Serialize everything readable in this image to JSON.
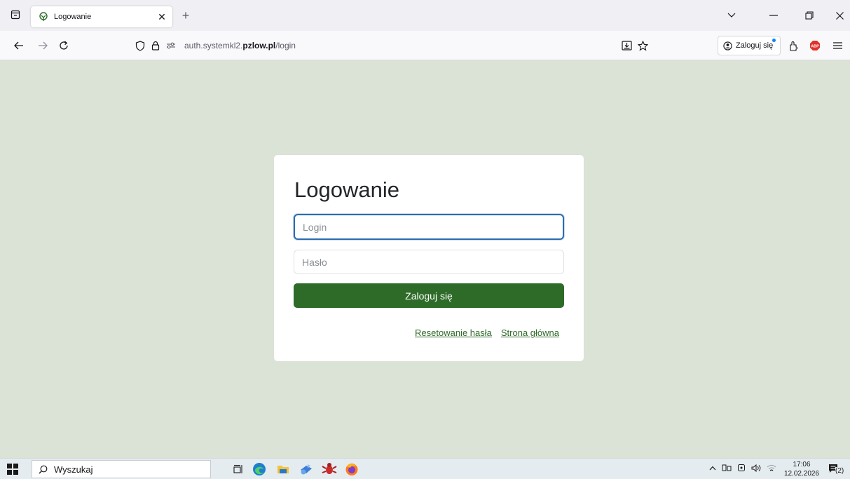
{
  "browser": {
    "tab": {
      "title": "Logowanie"
    },
    "url": {
      "prefix": "auth.systemkl2.",
      "domain": "pzlow.pl",
      "path": "/login"
    },
    "account_label": "Zaloguj się",
    "colors": {
      "tabstrip": "#f0f0f4",
      "toolbar": "#f9f9fb",
      "account_dot": "#0a84ff"
    }
  },
  "login": {
    "title": "Logowanie",
    "login_placeholder": "Login",
    "login_value": "",
    "password_placeholder": "Hasło",
    "password_value": "",
    "submit_label": "Zaloguj się",
    "links": {
      "reset": "Resetowanie hasła",
      "home": "Strona główna"
    },
    "colors": {
      "page_bg": "#dbe2d6",
      "primary": "#2e6b28",
      "focus": "#2b6cb0"
    }
  },
  "taskbar": {
    "search_placeholder": "Wyszukaj",
    "time": "17:06",
    "date": "12.02.2026",
    "notification_count": "2"
  }
}
